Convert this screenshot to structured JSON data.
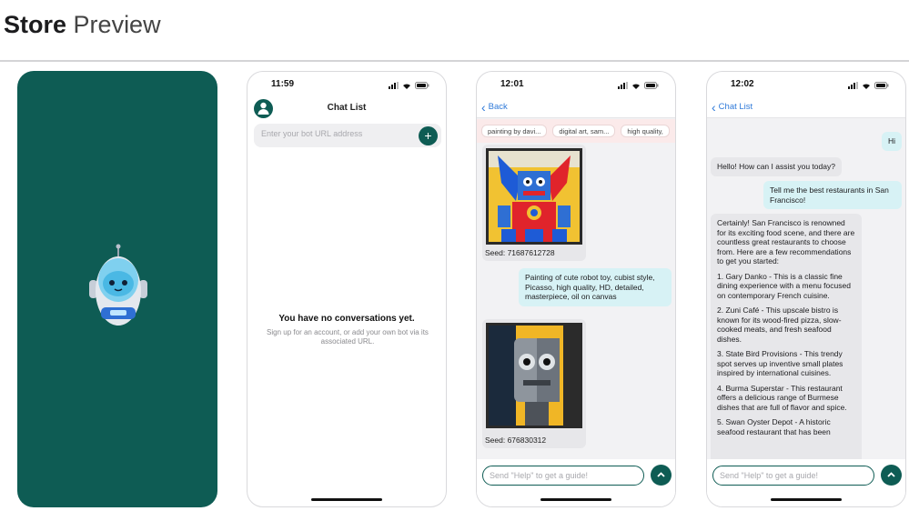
{
  "header": {
    "title_bold": "Store",
    "title_light": "Preview"
  },
  "colors": {
    "brand": "#0e5c54",
    "link": "#2f7ad9",
    "user_bubble": "#d7f2f5",
    "bot_bubble": "#e7e7ea",
    "chip_bg": "#fbeaea"
  },
  "icons": {
    "robot": "robot-mascot-icon",
    "avatar": "user-avatar-icon",
    "add": "plus-icon",
    "back": "chevron-left-icon",
    "send": "chevron-up-icon"
  },
  "phone2": {
    "time": "11:59",
    "title": "Chat List",
    "url_placeholder": "Enter your bot URL address",
    "add_symbol": "+",
    "empty_title": "You have no conversations yet.",
    "empty_subtitle": "Sign up for an account, or add your own bot via its associated URL."
  },
  "phone3": {
    "time": "12:01",
    "back_label": "Back",
    "chips": [
      "painting by davi...",
      "digital art, sam...",
      "high quality,"
    ],
    "image1_seed": "Seed: 71687612728",
    "prompt": "Painting of cute robot toy, cubist style, Picasso, high quality, HD, detailed, masterpiece, oil on canvas",
    "image2_seed": "Seed: 676830312",
    "input_placeholder": "Send \"Help\" to get a guide!"
  },
  "phone4": {
    "time": "12:02",
    "back_label": "Chat List",
    "msg_hi": "Hi",
    "msg_greeting": "Hello! How can I assist you today?",
    "msg_request": "Tell me the best restaurants in San Francisco!",
    "reply": {
      "intro": "Certainly! San Francisco is renowned for its exciting food scene, and there are countless great restaurants to choose from. Here are a few recommendations to get you started:",
      "r1": "1. Gary Danko - This is a classic fine dining experience with a menu focused on contemporary French cuisine.",
      "r2": "2. Zuni Café - This upscale bistro is known for its wood-fired pizza, slow-cooked meats, and fresh seafood dishes.",
      "r3": "3. State Bird Provisions - This trendy spot serves up inventive small plates inspired by international cuisines.",
      "r4": "4. Burma Superstar - This restaurant offers a delicious range of Burmese dishes that are full of flavor and spice.",
      "r5": "5. Swan Oyster Depot - A historic seafood restaurant that has been"
    },
    "input_placeholder": "Send \"Help\" to get a guide!"
  }
}
